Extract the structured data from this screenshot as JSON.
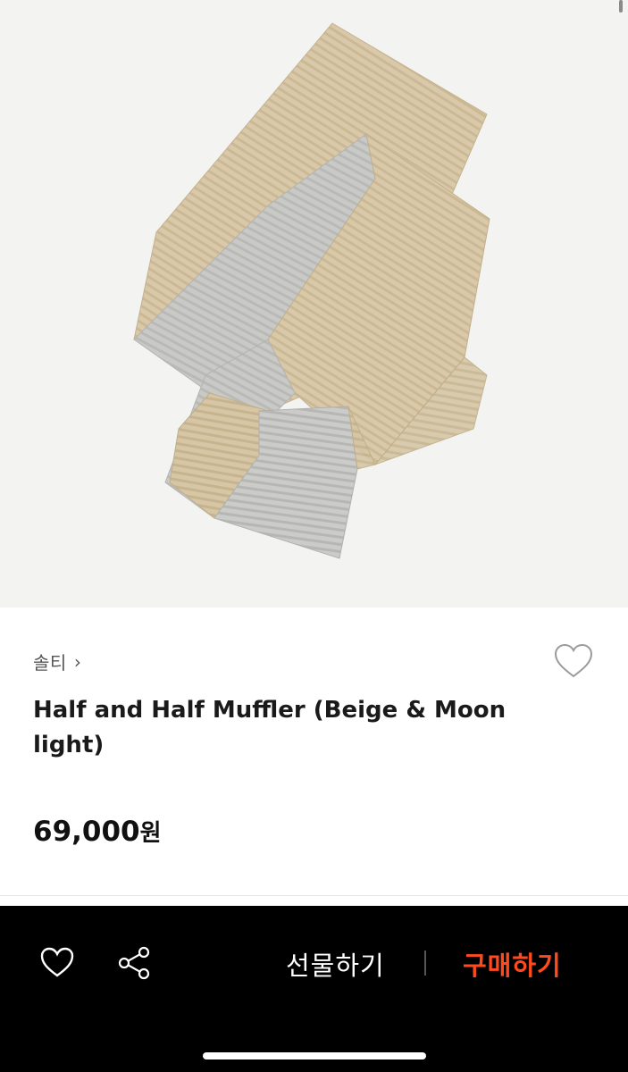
{
  "product": {
    "image_alt": "Half and Half Muffler scarf in beige and grey",
    "brand": "솔티",
    "brand_chevron": "›",
    "title": "Half and Half Muffler (Beige & Moon light)",
    "price_number": "69,000",
    "price_unit": "원"
  },
  "actions": {
    "gift_label": "선물하기",
    "buy_label": "구매하기"
  },
  "icons": {
    "wishlist": "heart-outline-icon",
    "share": "share-icon"
  },
  "colors": {
    "buy_accent": "#ff4a1f",
    "bar_background": "#000000",
    "image_background": "#f3f3f2"
  }
}
